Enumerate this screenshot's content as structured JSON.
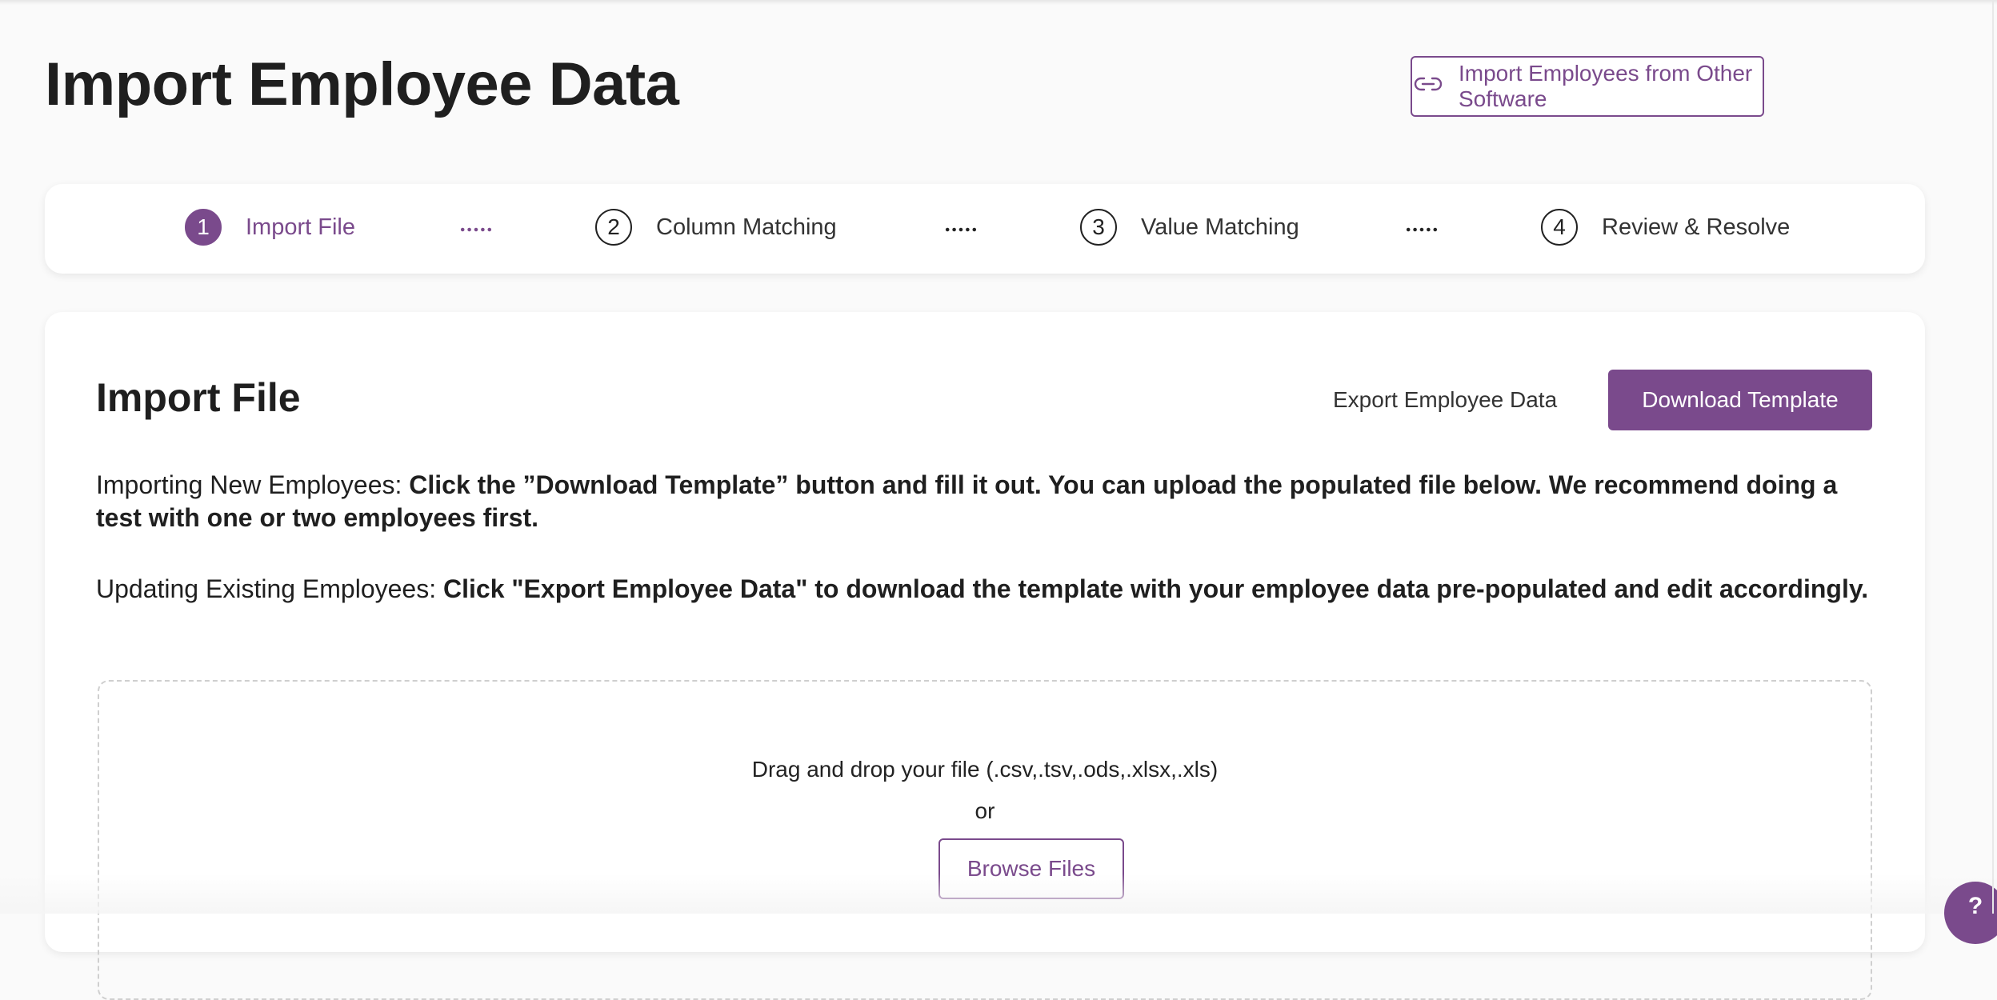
{
  "header": {
    "title": "Import Employee Data",
    "import_other_label": "Import Employees from Other Software",
    "import_other_icon": "link-icon"
  },
  "stepper": {
    "steps": [
      {
        "number": "1",
        "label": "Import File",
        "active": true
      },
      {
        "number": "2",
        "label": "Column Matching",
        "active": false
      },
      {
        "number": "3",
        "label": "Value Matching",
        "active": false
      },
      {
        "number": "4",
        "label": "Review & Resolve",
        "active": false
      }
    ]
  },
  "card": {
    "title": "Import File",
    "export_label": "Export Employee Data",
    "download_label": "Download Template",
    "new_employees_lead": "Importing New Employees: ",
    "new_employees_body": "Click the ”Download Template” button and fill it out. You can upload the populated file below. We recommend doing a test with one or two employees first.",
    "existing_employees_lead": "Updating Existing Employees: ",
    "existing_employees_body": "Click \"Export Employee Data\" to download the template with your employee data pre-populated and edit accordingly."
  },
  "dropzone": {
    "hint": "Drag and drop your file (.csv,.tsv,.ods,.xlsx,.xls)",
    "or": "or",
    "browse_label": "Browse Files"
  },
  "help": {
    "label": "?"
  },
  "colors": {
    "accent": "#7a4a8c",
    "background": "#fafafa",
    "card": "#ffffff"
  }
}
